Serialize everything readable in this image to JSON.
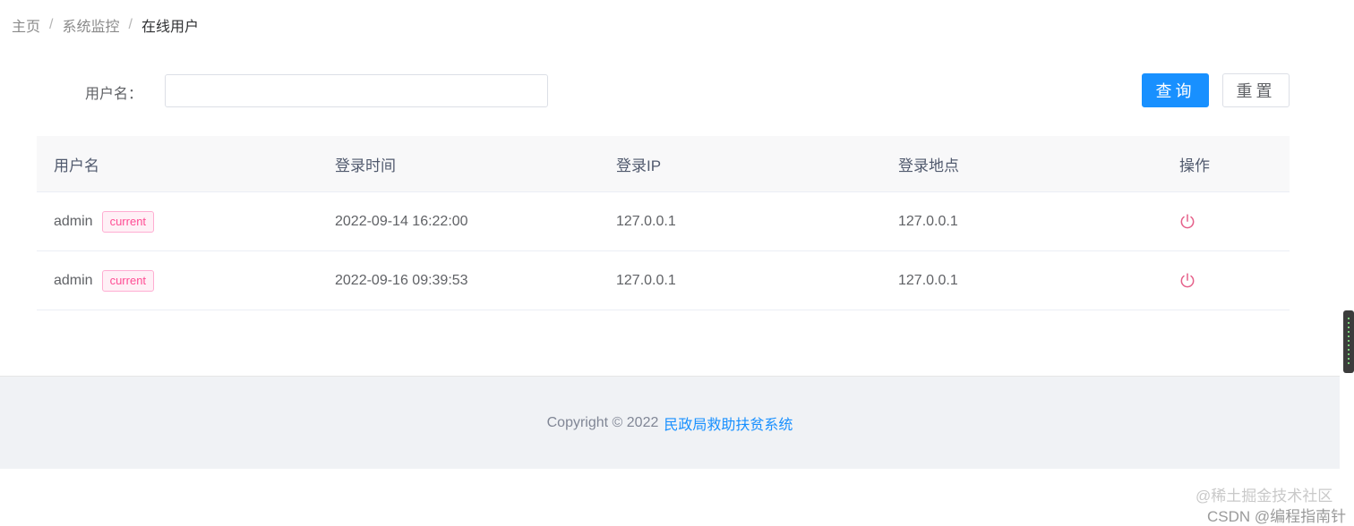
{
  "breadcrumb": {
    "home": "主页",
    "section": "系统监控",
    "current": "在线用户",
    "separator": "/"
  },
  "search": {
    "label": "用户名：",
    "value": "",
    "placeholder": ""
  },
  "buttons": {
    "query": "查询",
    "reset": "重置"
  },
  "table": {
    "headers": [
      "用户名",
      "登录时间",
      "登录IP",
      "登录地点",
      "操作"
    ],
    "rows": [
      {
        "username": "admin",
        "tag": "current",
        "login_time": "2022-09-14 16:22:00",
        "ip": "127.0.0.1",
        "location": "127.0.0.1",
        "action_icon": "power-icon"
      },
      {
        "username": "admin",
        "tag": "current",
        "login_time": "2022-09-16 09:39:53",
        "ip": "127.0.0.1",
        "location": "127.0.0.1",
        "action_icon": "power-icon"
      }
    ]
  },
  "footer": {
    "copyright": "Copyright © 2022",
    "system_name": "民政局救助扶贫系统"
  },
  "watermark": {
    "line1": "@稀土掘金技术社区",
    "line2": "CSDN @编程指南针"
  },
  "colors": {
    "primary": "#1890ff",
    "tag_pink": "#ff4d94",
    "icon_pink": "#e5608a"
  }
}
